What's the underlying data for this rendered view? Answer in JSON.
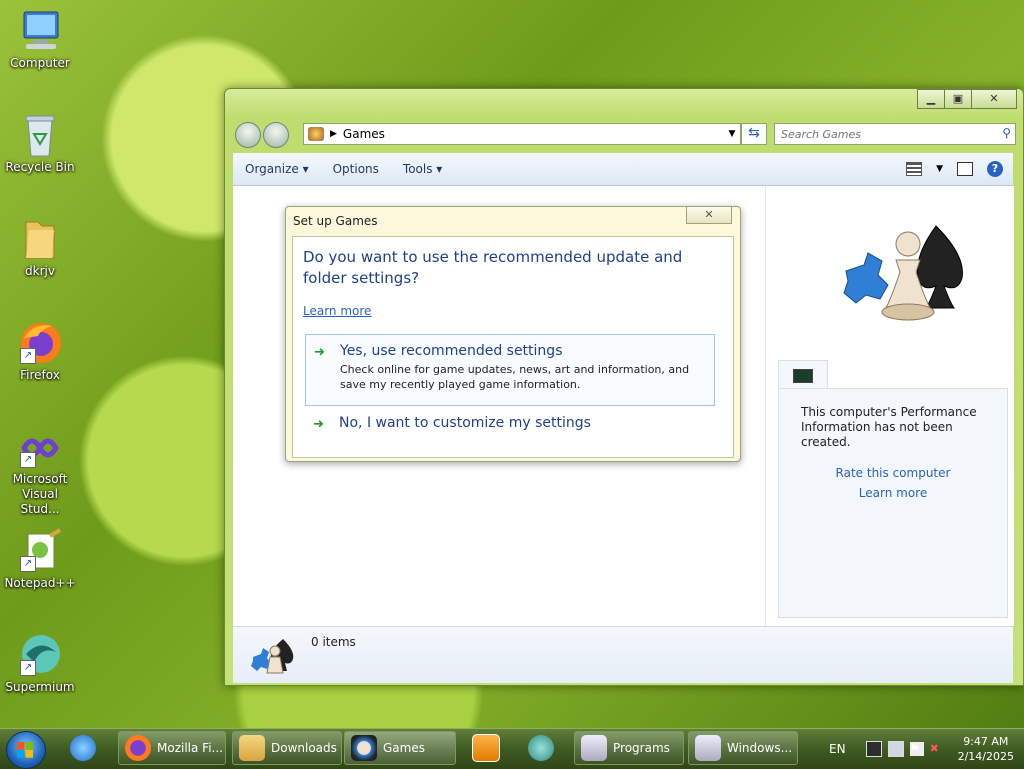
{
  "desktop": {
    "icons": [
      {
        "label": "Computer"
      },
      {
        "label": "Recycle Bin"
      },
      {
        "label": "dkrjv"
      },
      {
        "label": "Firefox"
      },
      {
        "label": "Microsoft Visual Stud..."
      },
      {
        "label": "Notepad++"
      },
      {
        "label": "Supermium"
      }
    ]
  },
  "window": {
    "address": {
      "crumb": "Games"
    },
    "search_placeholder": "Search Games",
    "toolbar": {
      "organize": "Organize",
      "options": "Options",
      "tools": "Tools"
    },
    "details": {
      "items_count": "0 items"
    },
    "performance": {
      "text": "This computer's Performance Information has not been created.",
      "rate_link": "Rate this computer",
      "learn_link": "Learn more"
    }
  },
  "dialog": {
    "title": "Set up Games",
    "question": "Do you want to use the recommended update and folder settings?",
    "learn_more": "Learn more",
    "option_yes": {
      "heading": "Yes, use recommended settings",
      "description": "Check online for game updates, news, art and information, and save my recently played game information."
    },
    "option_no": {
      "heading": "No, I want to customize my settings"
    }
  },
  "taskbar": {
    "buttons": [
      {
        "label": "Mozilla Fi..."
      },
      {
        "label": "Downloads"
      },
      {
        "label": "Games"
      },
      {
        "label": "Programs"
      },
      {
        "label": "Windows..."
      }
    ],
    "tray": {
      "language": "EN",
      "time": "9:47 AM",
      "date": "2/14/2025"
    }
  },
  "colors": {
    "link": "#2a62c4",
    "heading": "#1f3f8f",
    "green_arrow": "#1e9a2b"
  }
}
